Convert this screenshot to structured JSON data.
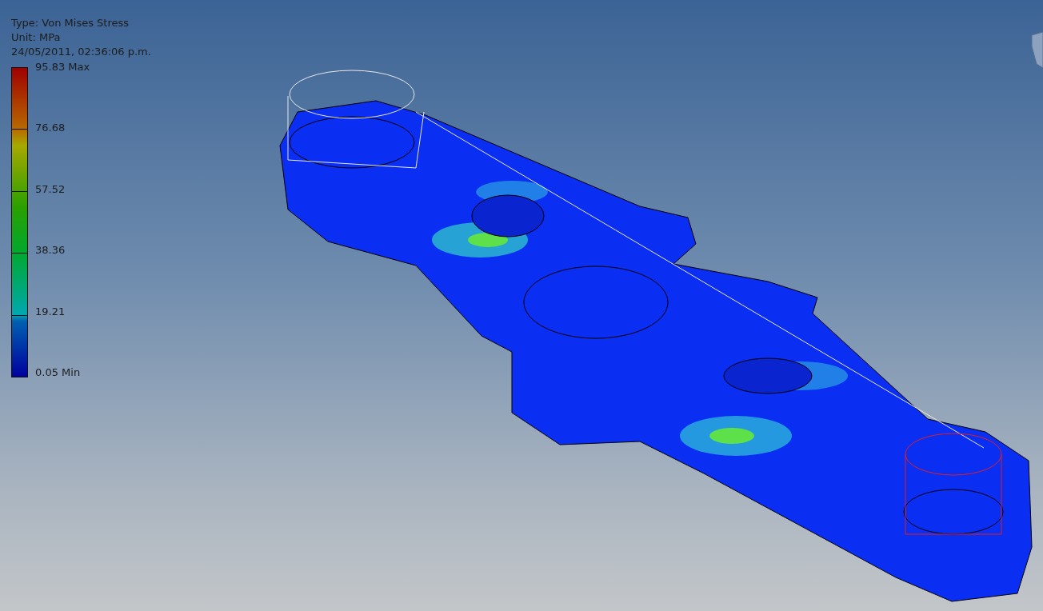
{
  "result": {
    "type_line": "Type: Von Mises Stress",
    "unit_line": "Unit: MPa",
    "timestamp": "24/05/2011, 02:36:06 p.m."
  },
  "legend": {
    "ticks": [
      "95.83 Max",
      "76.68",
      "57.52",
      "38.36",
      "19.21",
      "0.05 Min"
    ]
  }
}
